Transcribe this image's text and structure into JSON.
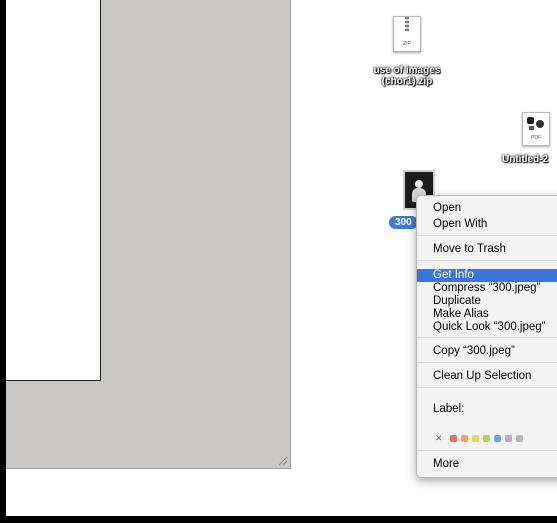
{
  "desktop": {
    "zip_file": {
      "name_line1": "use of images",
      "name_line2": "(chor1).zip",
      "badge": "ZIP"
    },
    "pdf_file": {
      "name": "Untitled-2",
      "badge": "PDF"
    },
    "jpeg_file": {
      "name": "300"
    }
  },
  "context_menu": {
    "items": {
      "open": "Open",
      "open_with": "Open With",
      "move_to_trash": "Move to Trash",
      "get_info": "Get Info",
      "compress": "Compress “300.jpeg”",
      "duplicate": "Duplicate",
      "make_alias": "Make Alias",
      "quick_look": "Quick Look “300.jpeg”",
      "copy": "Copy “300.jpeg”",
      "clean_up": "Clean Up Selection",
      "label": "Label:",
      "more": "More"
    },
    "highlighted": "Get Info",
    "label_colors": [
      "#f06a6a",
      "#f5a54a",
      "#f2d34e",
      "#a9d65a",
      "#6fa8e8",
      "#c79ee0",
      "#b8b8b8"
    ]
  }
}
